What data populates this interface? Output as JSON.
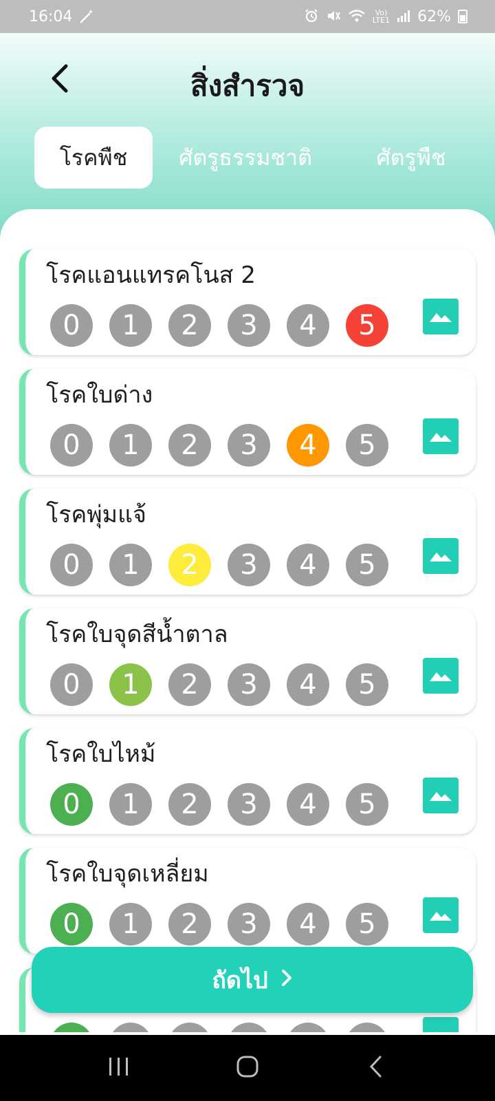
{
  "status_bar": {
    "time": "16:04",
    "battery": "62%",
    "icons": [
      "magic-wand-icon",
      "alarm-icon",
      "mute-icon",
      "wifi-icon",
      "volte-icon",
      "signal-icon",
      "battery-icon"
    ]
  },
  "header": {
    "title": "สิ่งสำรวจ",
    "back_icon": "chevron-left-icon"
  },
  "tabs": [
    {
      "label": "โรคพืช",
      "active": true
    },
    {
      "label": "ศัตรูธรรมชาติ",
      "active": false
    },
    {
      "label": "ศัตรูพืช",
      "active": false
    }
  ],
  "score_options": [
    "0",
    "1",
    "2",
    "3",
    "4",
    "5"
  ],
  "level_colors": {
    "0": "#4caf50",
    "1": "#8bc34a",
    "2": "#ffeb3b",
    "3": "#ffc107",
    "4": "#ff9800",
    "5": "#f44336",
    "unselected": "#9e9e9e"
  },
  "items": [
    {
      "name": "โรคแอนแทรคโนส 2",
      "selected": 5
    },
    {
      "name": "โรคใบด่าง",
      "selected": 4
    },
    {
      "name": "โรคพุ่มแจ้",
      "selected": 2
    },
    {
      "name": "โรคใบจุดสีน้ำตาล",
      "selected": 1
    },
    {
      "name": "โรคใบไหม้",
      "selected": 0
    },
    {
      "name": "โรคใบจุดเหลี่ยม",
      "selected": 0
    },
    {
      "name": "",
      "selected": 0
    }
  ],
  "footer": {
    "next_label": "ถัดไป"
  },
  "accent_color": "#22d2b8"
}
